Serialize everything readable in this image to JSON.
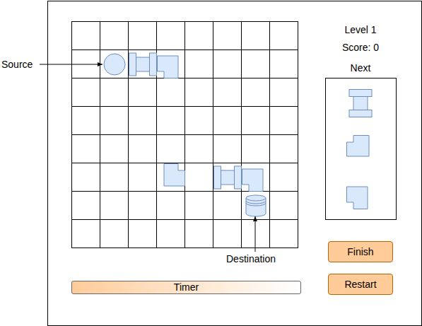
{
  "level": "Level 1",
  "score": "Score: 0",
  "next": {
    "title": "Next",
    "pieces": [
      {
        "kind": "straight",
        "rotation": 90
      },
      {
        "kind": "elbow",
        "rotation": 90
      },
      {
        "kind": "elbow",
        "rotation": 0
      }
    ]
  },
  "board": {
    "columns": 8,
    "rows": 8,
    "pieces": [
      {
        "kind": "source",
        "col": 1,
        "row": 1,
        "rotation": 0
      },
      {
        "kind": "straight",
        "col": 2,
        "row": 1,
        "rotation": 0
      },
      {
        "kind": "elbow",
        "col": 3,
        "row": 1,
        "rotation": 0
      },
      {
        "kind": "elbow",
        "col": 3,
        "row": 5,
        "rotation": 180
      },
      {
        "kind": "straight",
        "col": 5,
        "row": 5,
        "rotation": 0
      },
      {
        "kind": "elbow",
        "col": 6,
        "row": 5,
        "rotation": 0
      },
      {
        "kind": "destination",
        "col": 6,
        "row": 6,
        "rotation": 0
      }
    ]
  },
  "annotations": [
    {
      "label": "Source"
    },
    {
      "label": "Destination"
    }
  ],
  "timer": {
    "label": "Timer"
  },
  "buttons": [
    "Finish",
    "Restart"
  ]
}
